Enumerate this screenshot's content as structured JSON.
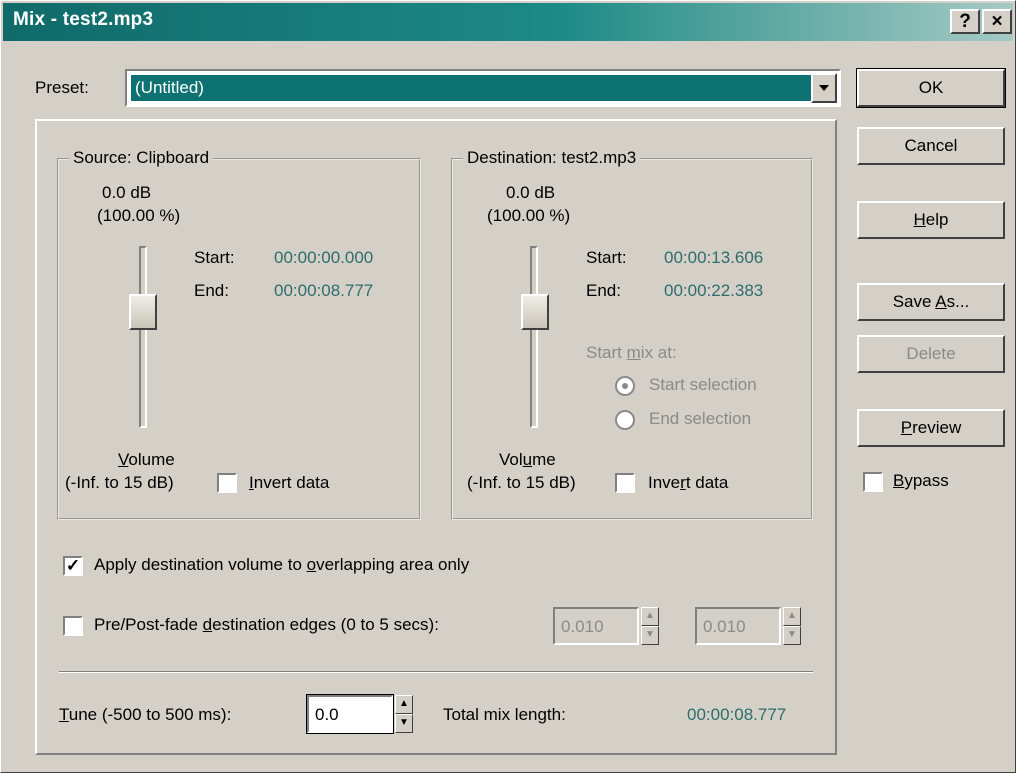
{
  "window": {
    "title": "Mix - test2.mp3",
    "help_btn": "?",
    "close_btn": "×"
  },
  "preset": {
    "label": "Preset:",
    "value": "(Untitled)"
  },
  "buttons": {
    "ok": "OK",
    "cancel": "Cancel",
    "help": "Help",
    "save_as": "Save As...",
    "delete": "Delete",
    "preview": "Preview"
  },
  "bypass": {
    "label": "Bypass",
    "checked": false
  },
  "source": {
    "title": "Source: Clipboard",
    "db": "0.0 dB",
    "percent": "(100.00 %)",
    "start_label": "Start:",
    "start": "00:00:00.000",
    "end_label": "End:",
    "end": "00:00:08.777",
    "volume_label": "Volume",
    "volume_range": "(-Inf. to 15 dB)",
    "invert_label": "Invert data",
    "invert_checked": false
  },
  "destination": {
    "title": "Destination: test2.mp3",
    "db": "0.0 dB",
    "percent": "(100.00 %)",
    "start_label": "Start:",
    "start": "00:00:13.606",
    "end_label": "End:",
    "end": "00:00:22.383",
    "start_mix_at": "Start mix at:",
    "radio_start": "Start selection",
    "radio_end": "End selection",
    "volume_label": "Volume",
    "volume_range": "(-Inf. to 15 dB)",
    "invert_label": "Invert data",
    "invert_checked": false
  },
  "options": {
    "apply_overlap": "Apply destination volume to overlapping area only",
    "apply_overlap_checked": true,
    "prepost_fade": "Pre/Post-fade destination edges (0 to 5 secs):",
    "prepost_fade_checked": false,
    "fade_in": "0.010",
    "fade_out": "0.010"
  },
  "tune": {
    "label": "Tune (-500 to 500 ms):",
    "value": "0.0",
    "total_label": "Total mix length:",
    "total_value": "00:00:08.777"
  }
}
